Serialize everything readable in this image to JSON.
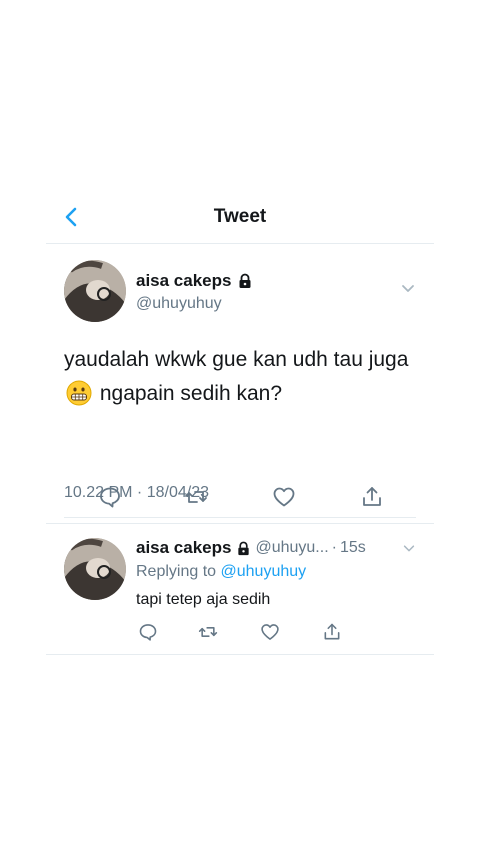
{
  "header": {
    "title": "Tweet",
    "back_icon": "chevron-left-icon"
  },
  "main_tweet": {
    "name": "aisa cakeps",
    "handle": "@uhuyuhuy",
    "protected_icon": "lock-icon",
    "text_before_emoji": "yaudalah wkwk gue kan udh tau juga",
    "emoji": "grimacing-face",
    "text_after_emoji": "ngapain sedih kan?",
    "timestamp": "10.22 PM · 18/04/23",
    "actions": [
      "reply-icon",
      "retweet-icon",
      "like-icon",
      "share-icon"
    ]
  },
  "reply": {
    "name": "aisa cakeps",
    "handle": "@uhuyu...",
    "separator": "·",
    "time": "15s",
    "replying_label": "Replying to",
    "replying_handle": "@uhuyuhuy",
    "text": "tapi tetep aja sedih",
    "actions": [
      "reply-icon",
      "retweet-icon",
      "like-icon",
      "share-icon"
    ]
  },
  "colors": {
    "accent": "#1da1f2",
    "secondary_text": "#657786",
    "divider": "#e6ecf0",
    "text": "#14171a"
  }
}
